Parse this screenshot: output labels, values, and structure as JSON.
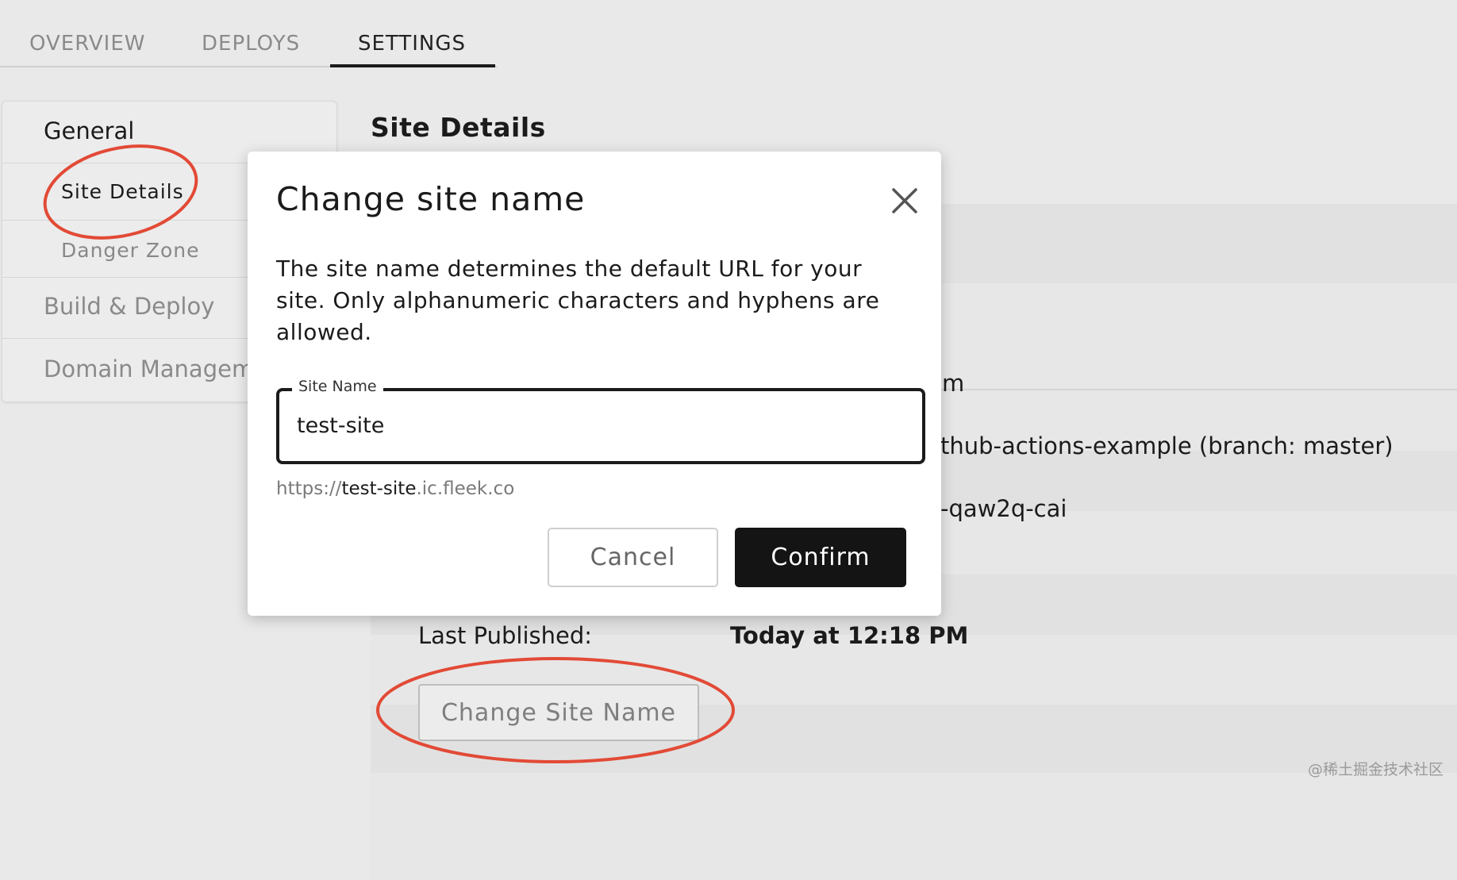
{
  "tabs": [
    {
      "label": "OVERVIEW"
    },
    {
      "label": "DEPLOYS"
    },
    {
      "label": "SETTINGS"
    }
  ],
  "sidebar": {
    "items": [
      {
        "label": "General"
      },
      {
        "label": "Site Details"
      },
      {
        "label": "Danger Zone"
      },
      {
        "label": "Build & Deploy"
      },
      {
        "label": "Domain Managem"
      }
    ]
  },
  "main": {
    "section_title": "Site Details",
    "fragments": {
      "row1": "m",
      "row2": "thub-actions-example (branch: master)",
      "row3": "-qaw2q-cai"
    },
    "last_published_label": "Last Published:",
    "last_published_value": "Today at 12:18 PM",
    "change_site_name_button": "Change Site Name"
  },
  "modal": {
    "title": "Change site name",
    "description": "The site name determines the default URL for your site. Only alphanumeric characters and hyphens are allowed.",
    "field_label": "Site Name",
    "field_value": "test-site",
    "url_prefix": "https://",
    "url_name": "test-site",
    "url_suffix": ".ic.fleek.co",
    "cancel_label": "Cancel",
    "confirm_label": "Confirm"
  },
  "watermark": "@稀土掘金技术社区",
  "colors": {
    "annotation": "#e24a36",
    "confirm_bg": "#141414"
  }
}
